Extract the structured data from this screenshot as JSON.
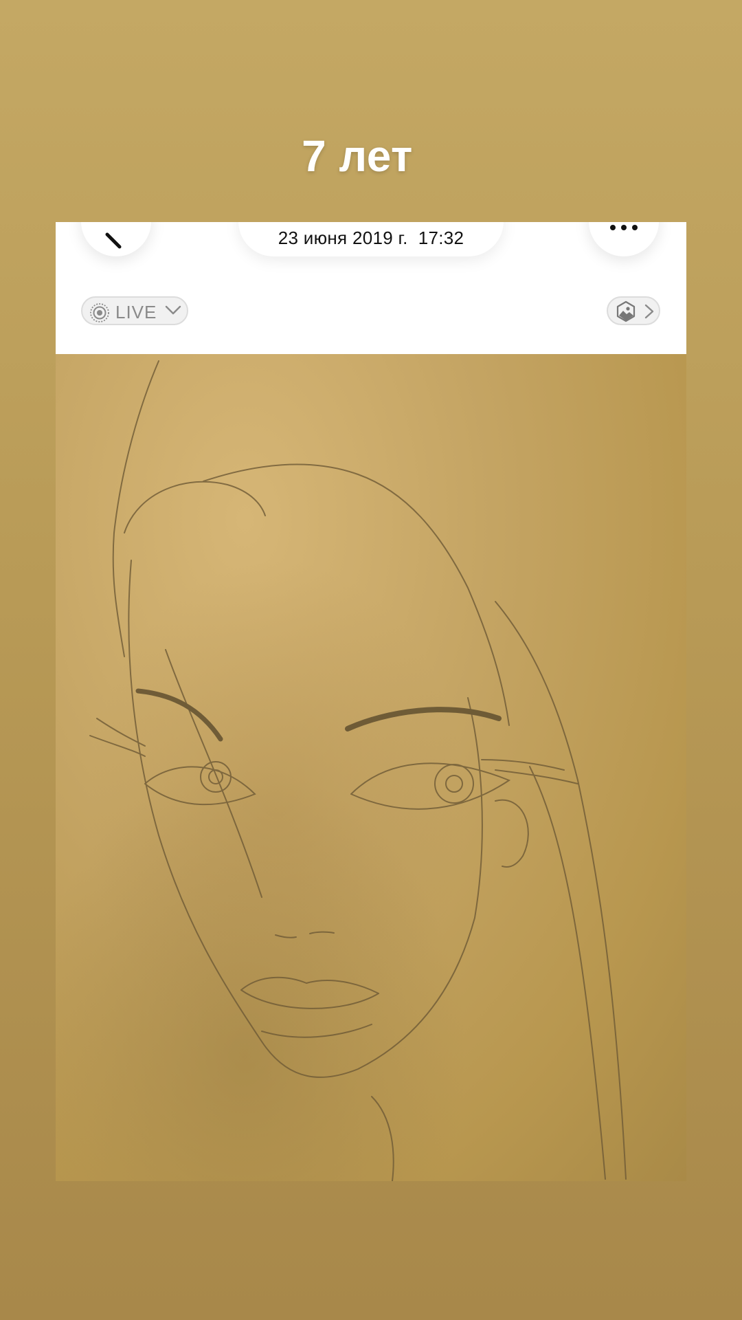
{
  "story": {
    "caption": "7 лет"
  },
  "screenshot": {
    "header": {
      "date_time": "23 июня 2019 г.  17:32",
      "back_icon": "chevron-left-icon",
      "more_icon": "ellipsis-icon"
    },
    "live_button": {
      "label": "LIVE",
      "icon": "live-photo-icon",
      "chevron": "chevron-down-icon"
    },
    "visual_lookup_button": {
      "icon": "visual-lookup-icon",
      "chevron": "chevron-right-icon"
    },
    "photo": {
      "subject": "pencil-sketch-face"
    }
  },
  "colors": {
    "background_top": "#c4a864",
    "background_bottom": "#a8884a",
    "caption": "#ffffff",
    "toolbar": "#ffffff",
    "paper": "#c4a463"
  }
}
